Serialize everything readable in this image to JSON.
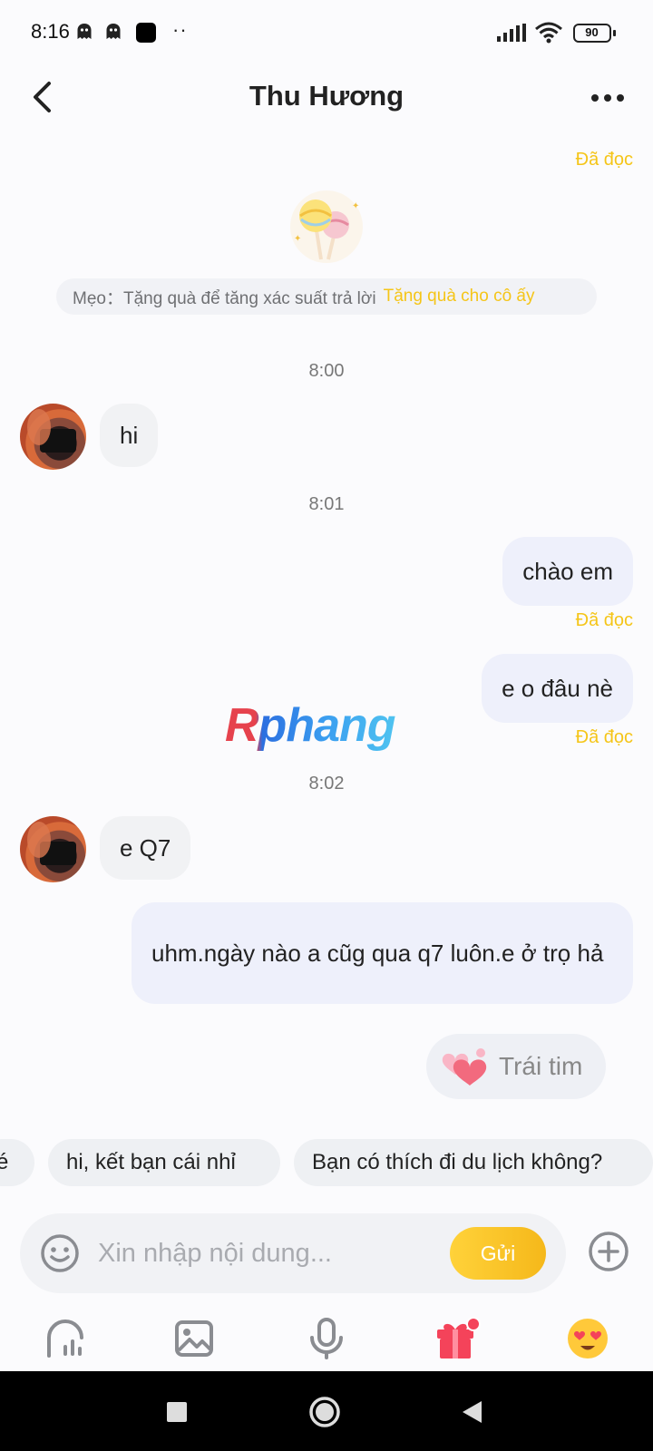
{
  "status_bar": {
    "time": "8:16",
    "dots": "··",
    "battery": "90"
  },
  "header": {
    "title": "Thu Hương",
    "back_icon": "chevron-left-icon",
    "more_icon": "more-horizontal-icon"
  },
  "tip": {
    "label": "Mẹo：Tặng quà để tăng xác suất trả lời",
    "link": "Tặng quà cho cô ấy",
    "gift_icon": "lollipop-icon"
  },
  "read_label": "Đã đọc",
  "messages": [
    {
      "direction": "out",
      "read": "Đã đọc"
    },
    {
      "timestamp": "8:00"
    },
    {
      "direction": "in",
      "text": "hi"
    },
    {
      "timestamp": "8:01"
    },
    {
      "direction": "out",
      "text": "chào em",
      "read": "Đã đọc"
    },
    {
      "direction": "out",
      "text": "e o đâu nè",
      "read": "Đã đọc"
    },
    {
      "timestamp": "8:02"
    },
    {
      "direction": "in",
      "text": "e Q7"
    },
    {
      "direction": "out",
      "text": "uhm.ngày nào a cũg qua q7 luôn.e ở trọ hả"
    }
  ],
  "watermark": "Rphang",
  "heart_chip": {
    "label": "Trái tim",
    "icon": "hearts-icon"
  },
  "quick_replies": [
    "é",
    "hi, kết bạn cái nhỉ",
    "Bạn có thích đi du lịch không?"
  ],
  "composer": {
    "placeholder": "Xin nhập nội dung...",
    "send_label": "Gửi"
  },
  "toolbar": [
    "chart-icon",
    "image-icon",
    "microphone-icon",
    "gift-icon",
    "emoji-heart-eyes-icon"
  ],
  "colors": {
    "accent": "#f5c518",
    "out_bubble": "#eef0fb",
    "in_bubble": "#f1f2f4",
    "gift": "#f4435a"
  }
}
